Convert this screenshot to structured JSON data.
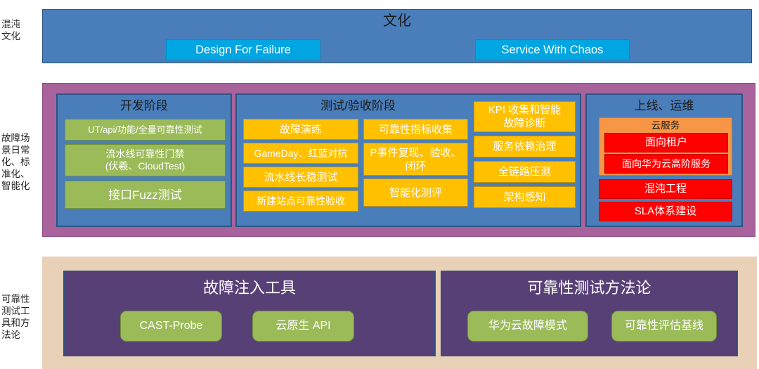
{
  "rows": [
    {
      "label": "混沌\n文化"
    },
    {
      "label": "故障场\n景日常\n化、标\n准化、\n智能化"
    },
    {
      "label": "可靠性\n测试工\n具和方\n法论"
    }
  ],
  "culture": {
    "title": "文化",
    "chips": [
      {
        "label": "Design For Failure"
      },
      {
        "label": "Service With Chaos"
      }
    ]
  },
  "fault_scenario": {
    "dev_stage": {
      "title": "开发阶段",
      "items": [
        {
          "label": "UT/api/功能/全量可靠性测试"
        },
        {
          "label": "流水线可靠性门禁\n(伏羲、CloudTest)"
        },
        {
          "label": "接口Fuzz测试"
        }
      ]
    },
    "test_stage": {
      "title": "测试/验收阶段",
      "col1": [
        {
          "label": "故障演练"
        },
        {
          "label": "GameDay、红蓝对抗"
        },
        {
          "label": "流水线长稳测试"
        },
        {
          "label": "新建站点可靠性验收"
        }
      ],
      "col2": [
        {
          "label": "可靠性指标收集"
        },
        {
          "label": "P事件复现、验收、\n闭环"
        },
        {
          "label": "智能化测评"
        }
      ],
      "col3": [
        {
          "label": "KPI 收集和智能\n故障诊断"
        },
        {
          "label": "服务依赖治理"
        },
        {
          "label": "全链路压测"
        },
        {
          "label": "架构感知"
        }
      ]
    },
    "ops_stage": {
      "title": "上线、运维",
      "cloud_service": {
        "title": "云服务",
        "items": [
          {
            "label": "面向租户"
          },
          {
            "label": "面向华为云高阶服务"
          }
        ]
      },
      "items": [
        {
          "label": "混沌工程"
        },
        {
          "label": "SLA体系建设"
        }
      ]
    }
  },
  "tools": {
    "fault_injection": {
      "title": "故障注入工具",
      "items": [
        {
          "label": "CAST-Probe"
        },
        {
          "label": "云原生 API"
        }
      ]
    },
    "methodology": {
      "title": "可靠性测试方法论",
      "items": [
        {
          "label": "华为云故障模式"
        },
        {
          "label": "可靠性评估基线"
        }
      ]
    }
  },
  "colors": {
    "culture_band": "#4a7ebb",
    "fault_band": "#a8639d",
    "tools_band": "#e9d1b8",
    "chip_blue": "#00a6e2",
    "chip_green": "#9bbb59",
    "chip_amber": "#ffc000",
    "chip_red": "#ff0000",
    "box_orange": "#f79646",
    "panel_purple": "#574076"
  }
}
